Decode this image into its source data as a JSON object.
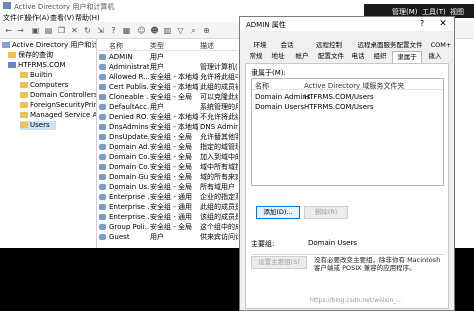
{
  "main": {
    "title": "Active Directory 用户和计算机",
    "menu": [
      "文件(F)",
      "操作(A)",
      "查看(V)",
      "帮助(H)"
    ],
    "tree": [
      {
        "label": "Active Directory 用户和计算机",
        "level": 0,
        "icon": "ad-icon"
      },
      {
        "label": "保存的查询",
        "level": 1,
        "icon": "folder-icon"
      },
      {
        "label": "HTFRMS.COM",
        "level": 1,
        "icon": "domain-icon"
      },
      {
        "label": "Builtin",
        "level": 2,
        "icon": "folder-icon"
      },
      {
        "label": "Computers",
        "level": 2,
        "icon": "folder-icon"
      },
      {
        "label": "Domain Controllers",
        "level": 2,
        "icon": "folder-icon"
      },
      {
        "label": "ForeignSecurityPrincip...",
        "level": 2,
        "icon": "folder-icon"
      },
      {
        "label": "Managed Service Acco...",
        "level": 2,
        "icon": "folder-icon"
      },
      {
        "label": "Users",
        "level": 2,
        "icon": "folder-icon",
        "selected": true
      }
    ],
    "columns": [
      "名称",
      "类型",
      "描述"
    ],
    "rows": [
      {
        "name": "ADMIN",
        "type": "用户",
        "desc": ""
      },
      {
        "name": "Administrat...",
        "type": "用户",
        "desc": "管理计算机(域)的..."
      },
      {
        "name": "Allowed R...",
        "type": "安全组 - 本地域",
        "desc": "允许将此组中的成..."
      },
      {
        "name": "Cert Publis...",
        "type": "安全组 - 本地域",
        "desc": "此组的成员被允许..."
      },
      {
        "name": "Cloneable ...",
        "type": "安全组 - 全局",
        "desc": "可以克隆此组中作..."
      },
      {
        "name": "DefaultAcc...",
        "type": "用户",
        "desc": "系统管理的用户帐..."
      },
      {
        "name": "Denied RO...",
        "type": "安全组 - 本地域",
        "desc": "不允许将此组中的..."
      },
      {
        "name": "DnsAdmins",
        "type": "安全组 - 本地域",
        "desc": "DNS Administrat..."
      },
      {
        "name": "DnsUpdate...",
        "type": "安全组 - 全局",
        "desc": "允许替其他客户端..."
      },
      {
        "name": "Domain Ad...",
        "type": "安全组 - 全局",
        "desc": "指定的域管理员"
      },
      {
        "name": "Domain Co...",
        "type": "安全组 - 全局",
        "desc": "加入到域中的所有..."
      },
      {
        "name": "Domain Co...",
        "type": "安全组 - 全局",
        "desc": "域中所有域控制器"
      },
      {
        "name": "Domain Gu...",
        "type": "安全组 - 全局",
        "desc": "域的所有来宾"
      },
      {
        "name": "Domain Us...",
        "type": "安全组 - 全局",
        "desc": "所有域用户"
      },
      {
        "name": "Enterprise ...",
        "type": "安全组 - 通用",
        "desc": "企业的指定系统管..."
      },
      {
        "name": "Enterprise ...",
        "type": "安全组 - 通用",
        "desc": "此组的成员是企业..."
      },
      {
        "name": "Enterprise ...",
        "type": "安全组 - 通用",
        "desc": "该组的成员是企业..."
      },
      {
        "name": "Group Poli...",
        "type": "安全组 - 全局",
        "desc": "这个组中的成员可..."
      },
      {
        "name": "Guest",
        "type": "用户",
        "desc": "供来宾访问计算机..."
      }
    ]
  },
  "dialog": {
    "title": "ADMIN 属性",
    "help": "?",
    "close": "✕",
    "tabs_row1": [
      "环境",
      "会话",
      "远程控制",
      "远程桌面服务配置文件",
      "COM+"
    ],
    "tabs_row2": [
      "常规",
      "地址",
      "帐户",
      "配置文件",
      "电话",
      "组织",
      "隶属于",
      "拨入"
    ],
    "active_tab": "隶属于",
    "member_of_label": "隶属于(M):",
    "member_columns": [
      "名称",
      "Active Directory 域服务文件夹"
    ],
    "members": [
      {
        "name": "Domain Admins",
        "folder": "HTFRMS.COM/Users"
      },
      {
        "name": "Domain Users",
        "folder": "HTFRMS.COM/Users"
      }
    ],
    "add_button": "添加(D)...",
    "remove_button": "删除(R)",
    "primary_group_label": "主要组:",
    "primary_group_value": "Domain Users",
    "set_primary_button": "设置主要组(S)",
    "note": "没有必要改变主要组，除非你有 Macintosh 客户端或 POSIX 兼容的应用程序。"
  },
  "strip": [
    "管理(M)",
    "工具(T)",
    "视图"
  ],
  "watermark": "https://blog.csdn.net/weixin_..."
}
